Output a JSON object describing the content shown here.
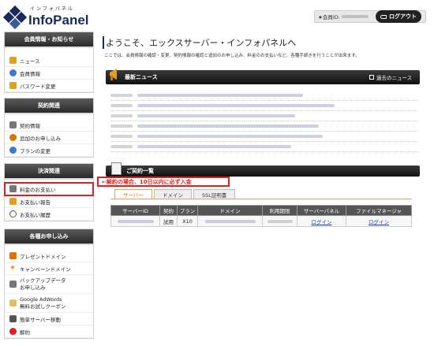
{
  "header": {
    "logo_small": "インフォパネル",
    "logo_main": "InfoPanel",
    "member_label": "★会員ID:",
    "logout_label": "ログアウト"
  },
  "sidebar": {
    "sections": [
      {
        "title": "会員情報・お知らせ",
        "items": [
          {
            "label": "ニュース",
            "icon": "news-icon",
            "color": "#e0a020"
          },
          {
            "label": "会員情報",
            "icon": "member-icon",
            "color": "#3a7ad0"
          },
          {
            "label": "パスワード変更",
            "icon": "lock-icon",
            "color": "#e0a020"
          }
        ]
      },
      {
        "title": "契約関連",
        "items": [
          {
            "label": "契約情報",
            "icon": "contract-icon",
            "color": "#777"
          },
          {
            "label": "追加のお申し込み",
            "icon": "plus-icon",
            "color": "#e07000"
          },
          {
            "label": "プランの変更",
            "icon": "refresh-icon",
            "color": "#3a7ad0"
          }
        ]
      },
      {
        "title": "決済関連",
        "items": [
          {
            "label": "料金のお支払い",
            "icon": "payment-icon",
            "color": "#777"
          },
          {
            "label": "お支払い報告",
            "icon": "report-icon",
            "color": "#e0a020"
          },
          {
            "label": "お支払い履歴",
            "icon": "clock-icon",
            "color": "#555"
          }
        ]
      },
      {
        "title": "各種お申し込み",
        "items": [
          {
            "label": "プレゼントドメイン",
            "icon": "gift-icon",
            "color": "#e07000"
          },
          {
            "label": "キャンペーンドメイン",
            "icon": "star-icon",
            "color": "#e0a020"
          },
          {
            "label": "バックアップデータ\nお申し込み",
            "icon": "backup-icon",
            "color": "#777"
          },
          {
            "label": "Google AdWords\n無料お試しクーポン",
            "icon": "coupon-icon",
            "color": "#e0a020"
          },
          {
            "label": "簡単サーバー移動",
            "icon": "server-icon",
            "color": "#555"
          },
          {
            "label": "解約",
            "icon": "cancel-icon",
            "color": "#e02020"
          }
        ]
      }
    ]
  },
  "main": {
    "title": "ようこそ、エックスサーバー・インフォパネルへ",
    "description": "ここでは、会員情報の確認・変更、契約情報の確認と追加のお申し込み、料金のお支払いなど、各種手続きを行うことが出来ます。",
    "news_title": "最新ニュース",
    "past_news": "過去のニュース",
    "contract_title": "ご契約一覧",
    "notice": "←解約の場合、10日以内に必ず入金",
    "tabs": [
      "サーバー",
      "ドメイン",
      "SSL証明書"
    ],
    "table": {
      "headers": [
        "サーバーID",
        "契約",
        "プラン",
        "ドメイン",
        "利用期限",
        "サーバーパネル",
        "ファイルマネージャ"
      ],
      "row": {
        "contract": "試用",
        "plan": "X10",
        "panel_link": "ログイン",
        "fm_link": "ログイン"
      }
    }
  }
}
